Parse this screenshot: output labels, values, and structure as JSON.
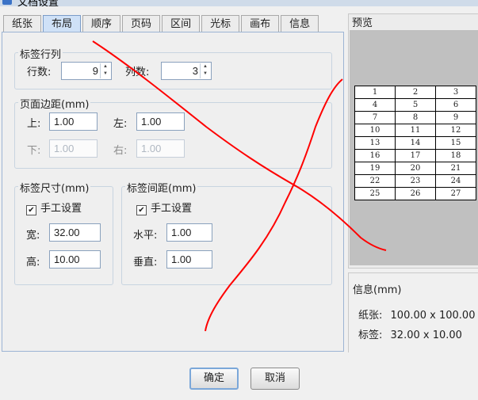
{
  "window": {
    "title": "文档设置"
  },
  "tabs": [
    {
      "label": "纸张",
      "active": false
    },
    {
      "label": "布局",
      "active": true
    },
    {
      "label": "顺序",
      "active": false
    },
    {
      "label": "页码",
      "active": false
    },
    {
      "label": "区间",
      "active": false
    },
    {
      "label": "光标",
      "active": false
    },
    {
      "label": "画布",
      "active": false
    },
    {
      "label": "信息",
      "active": false
    }
  ],
  "layout": {
    "rows_cols": {
      "title": "标签行列",
      "rows_label": "行数:",
      "rows_value": "9",
      "cols_label": "列数:",
      "cols_value": "3"
    },
    "margins": {
      "title": "页面边距(mm)",
      "top_label": "上:",
      "top_value": "1.00",
      "left_label": "左:",
      "left_value": "1.00",
      "bottom_label": "下:",
      "bottom_value": "1.00",
      "right_label": "右:",
      "right_value": "1.00"
    },
    "size": {
      "title": "标签尺寸(mm)",
      "manual_label": "手工设置",
      "manual_checked": true,
      "width_label": "宽:",
      "width_value": "32.00",
      "height_label": "高:",
      "height_value": "10.00"
    },
    "spacing": {
      "title": "标签间距(mm)",
      "manual_label": "手工设置",
      "manual_checked": true,
      "h_label": "水平:",
      "h_value": "1.00",
      "v_label": "垂直:",
      "v_value": "1.00"
    }
  },
  "preview": {
    "title": "预览",
    "cells": [
      [
        "1",
        "2",
        "3"
      ],
      [
        "4",
        "5",
        "6"
      ],
      [
        "7",
        "8",
        "9"
      ],
      [
        "10",
        "11",
        "12"
      ],
      [
        "13",
        "14",
        "15"
      ],
      [
        "16",
        "17",
        "18"
      ],
      [
        "19",
        "20",
        "21"
      ],
      [
        "22",
        "23",
        "24"
      ],
      [
        "25",
        "26",
        "27"
      ]
    ]
  },
  "info": {
    "title": "信息(mm)",
    "paper_label": "纸张:",
    "paper_value": "100.00 x 100.00",
    "label_label": "标签:",
    "label_value": "32.00 x 10.00"
  },
  "buttons": {
    "ok": "确定",
    "cancel": "取消"
  },
  "colors": {
    "annotation": "#ff0000",
    "active_tab": "#cfe1f7",
    "preview_bg": "#c0c0c0"
  }
}
